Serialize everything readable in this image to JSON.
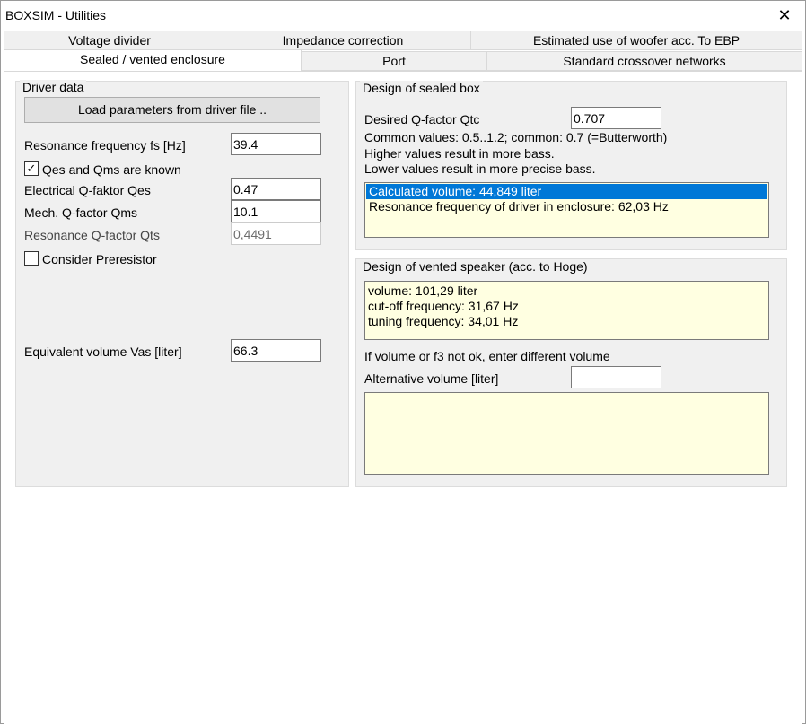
{
  "window": {
    "title": "BOXSIM - Utilities"
  },
  "tabs": {
    "row1": [
      "Voltage divider",
      "Impedance correction",
      "Estimated use of woofer acc. To EBP"
    ],
    "row2": [
      "Sealed / vented enclosure",
      "Port",
      "Standard crossover networks"
    ],
    "active": "Sealed / vented enclosure"
  },
  "driver": {
    "title": "Driver data",
    "load_button": "Load parameters  from driver file ..",
    "fs_label": "Resonance frequency fs [Hz]",
    "fs_value": "39.4",
    "qes_qms_check_label": "Qes and Qms are known",
    "qes_qms_checked": "✓",
    "qes_label": "Electrical Q-faktor Qes",
    "qes_value": "0.47",
    "qms_label": "Mech. Q-factor Qms",
    "qms_value": "10.1",
    "qts_label": "Resonance Q-factor Qts",
    "qts_value": "0,4491",
    "preresistor_label": "Consider Preresistor",
    "vas_label": "Equivalent volume Vas [liter]",
    "vas_value": "66.3"
  },
  "sealed": {
    "title": "Design of sealed box",
    "qtc_label": "Desired Q-factor Qtc",
    "qtc_value": "0.707",
    "hint1": "Common values: 0.5..1.2; common: 0.7 (=Butterworth)",
    "hint2": "Higher values result in more bass.",
    "hint3": "Lower values result in more precise bass.",
    "results": [
      "Calculated volume: 44,849 liter",
      "Resonance frequency of driver in enclosure: 62,03 Hz"
    ]
  },
  "vented": {
    "title": "Design of vented speaker (acc. to Hoge)",
    "results": [
      "volume: 101,29 liter",
      "cut-off frequency: 31,67 Hz",
      "tuning frequency: 34,01 Hz"
    ],
    "hint": "If volume or f3 not ok, enter different volume",
    "alt_label": "Alternative volume [liter]",
    "alt_value": ""
  },
  "colors": {
    "selection": "#0078d7",
    "info_bg": "#ffffe1",
    "group_bg": "#f0f0f0"
  }
}
